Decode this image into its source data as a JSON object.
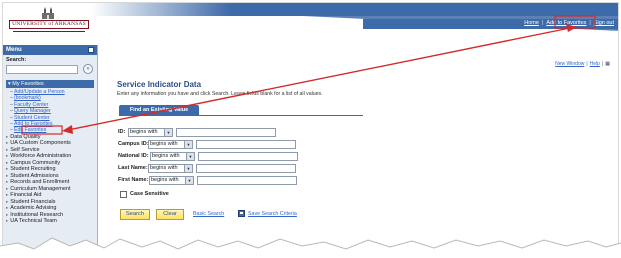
{
  "header": {
    "logo_text": "UNIVERSITY of ARKANSAS",
    "links": [
      "Home",
      "Add to Favorites",
      "Sign out"
    ]
  },
  "menu": {
    "title": "Menu",
    "search_label": "Search:",
    "search_go_symbol": "»",
    "favorites_label": "My Favorites",
    "favorites": [
      "Add/Update a Person",
      "(bookmark)",
      "Faculty Center",
      "Query Manager",
      "Student Center",
      "Add to Favorites",
      "Edit Favorites"
    ],
    "categories": [
      "Data Quality",
      "UA Custom Components",
      "Self Service",
      "Workforce Administration",
      "Campus Community",
      "Student Recruiting",
      "Student Admissions",
      "Records and Enrollment",
      "Curriculum Management",
      "Financial Aid",
      "Student Financials",
      "Academic Advising",
      "Institutional Research",
      "UA Technical Team"
    ]
  },
  "page": {
    "util_links": [
      "New Window",
      "Help"
    ],
    "title": "Service Indicator Data",
    "instructions": "Enter any information you have and click Search. Leave fields blank for a list of all values.",
    "tab_label": "Find an Existing Value",
    "fields": [
      {
        "label": "ID:",
        "operator": "begins with",
        "value": ""
      },
      {
        "label": "Campus ID:",
        "operator": "begins with",
        "value": ""
      },
      {
        "label": "National ID:",
        "operator": "begins with",
        "value": ""
      },
      {
        "label": "Last Name:",
        "operator": "begins with",
        "value": ""
      },
      {
        "label": "First Name:",
        "operator": "begins with",
        "value": ""
      }
    ],
    "case_sensitive_label": "Case Sensitive",
    "case_sensitive_checked": false,
    "search_button": "Search",
    "clear_button": "Clear",
    "basic_search_link": "Basic Search",
    "save_criteria_link": "Save Search Criteria"
  },
  "colors": {
    "brand_blue": "#3d6aa8",
    "annotation_red": "#d42a2a",
    "button_yellow": "#ffe066",
    "link_blue": "#3366cc"
  }
}
